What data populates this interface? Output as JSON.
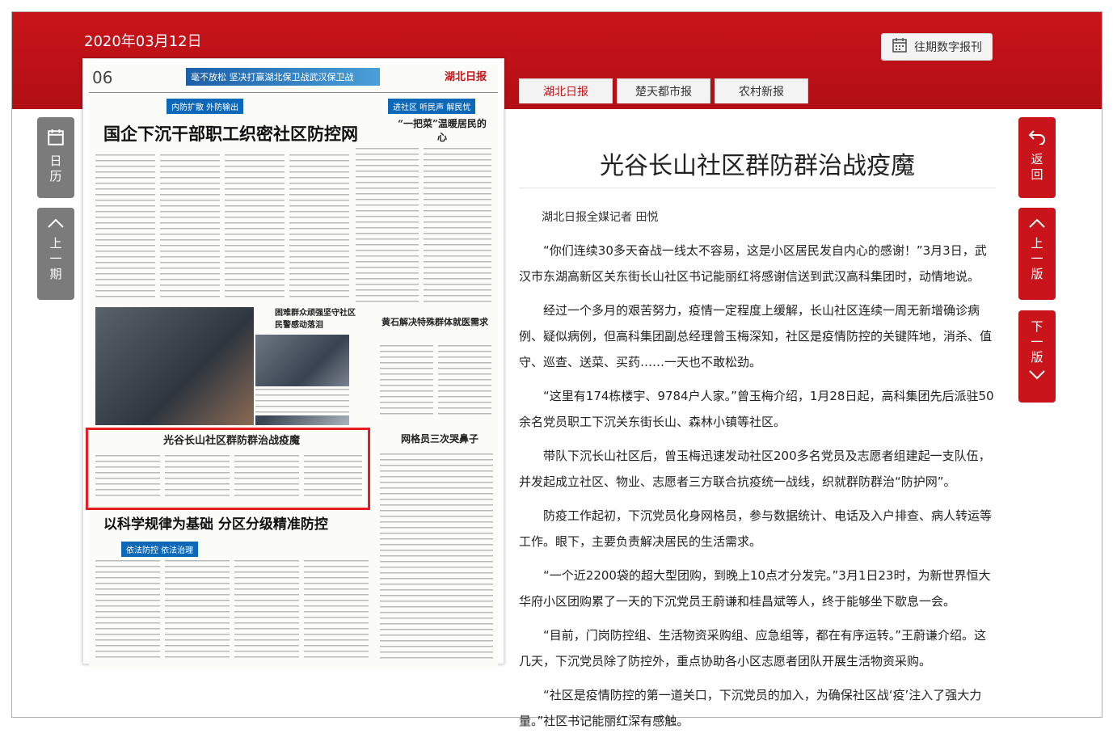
{
  "header": {
    "date": "2020年03月12日",
    "archive_label": "往期数字报刊"
  },
  "tabs": [
    {
      "label": "湖北日报",
      "active": true
    },
    {
      "label": "楚天都市报",
      "active": false
    },
    {
      "label": "农村新报",
      "active": false
    }
  ],
  "left_nav": {
    "calendar": "日历",
    "prev_issue": "上一期"
  },
  "right_nav": {
    "back": "返回",
    "prev_page": "上一版",
    "next_page": "下一版"
  },
  "newspaper": {
    "page_number": "06",
    "banner": "毫不放松 坚决打赢湖北保卫战武汉保卫战",
    "masthead": "湖北日报",
    "section_tag_1": "内防扩散 外防输出",
    "section_tag_2": "进社区 听民声 解民忧",
    "headline_1": "国企下沉干部职工织密社区防控网",
    "sub_1": "“一把菜”温暖居民的心",
    "sub_2": "困难群众顽强坚守社区民警感动落泪",
    "sub_3": "黄石解决特殊群体就医需求",
    "sub_4": "网格员三次哭鼻子",
    "highlighted_headline": "光谷长山社区群防群治战疫魔",
    "headline_2": "以科学规律为基础 分区分级精准防控",
    "section_tag_3": "依法防控 依法治理"
  },
  "article": {
    "title": "光谷长山社区群防群治战疫魔",
    "byline": "湖北日报全媒记者 田悦",
    "paragraphs": [
      "“你们连续30多天奋战一线太不容易，这是小区居民发自内心的感谢！”3月3日，武汉市东湖高新区关东街长山社区书记能丽红将感谢信送到武汉高科集团时，动情地说。",
      "经过一个多月的艰苦努力，疫情一定程度上缓解，长山社区连续一周无新增确诊病例、疑似病例，但高科集团副总经理曾玉梅深知，社区是疫情防控的关键阵地，消杀、值守、巡查、送菜、买药……一天也不敢松劲。",
      "“这里有174栋楼宇、9784户人家。”曾玉梅介绍，1月28日起，高科集团先后派驻50余名党员职工下沉关东街长山、森林小镇等社区。",
      "带队下沉长山社区后，曾玉梅迅速发动社区200多名党员及志愿者组建起一支队伍，并发起成立社区、物业、志愿者三方联合抗疫统一战线，织就群防群治“防护网”。",
      "防疫工作起初，下沉党员化身网格员，参与数据统计、电话及入户排查、病人转运等工作。眼下，主要负责解决居民的生活需求。",
      "“一个近2200袋的超大型团购，到晚上10点才分发完。”3月1日23时，为新世界恒大华府小区团购累了一天的下沉党员王蔚谦和桂昌斌等人，终于能够坐下歇息一会。",
      "“目前，门岗防控组、生活物资采购组、应急组等，都在有序运转。”王蔚谦介绍。这几天，下沉党员除了防控外，重点协助各小区志愿者团队开展生活物资采购。",
      "“社区是疫情防控的第一道关口，下沉党员的加入，为确保社区战‘疫’注入了强大力量。”社区书记能丽红深有感触。"
    ]
  },
  "colors": {
    "brand_red": "#c8141a",
    "nav_gray": "#7b7b7b",
    "highlight_red": "#e51c23"
  }
}
